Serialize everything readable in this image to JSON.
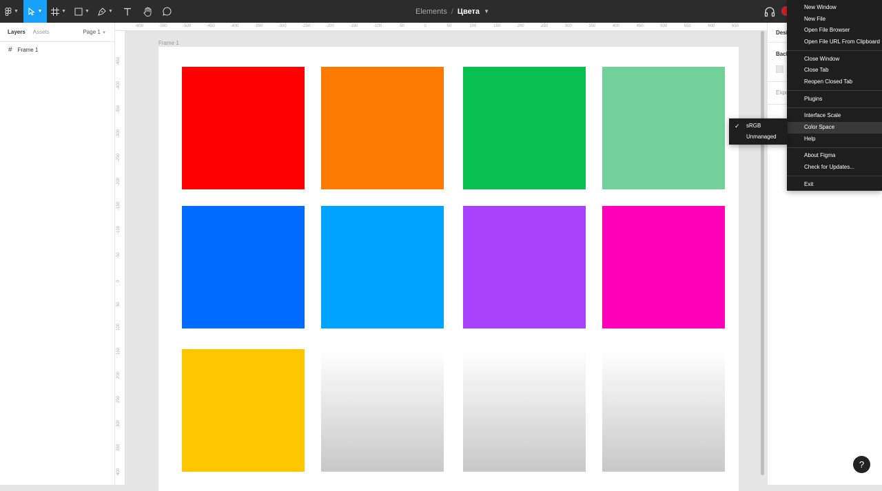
{
  "toolbar": {
    "tools": [
      {
        "name": "main-menu-icon"
      },
      {
        "name": "move-icon"
      },
      {
        "name": "frame-icon"
      },
      {
        "name": "shape-icon"
      },
      {
        "name": "pen-icon"
      },
      {
        "name": "text-icon"
      },
      {
        "name": "hand-icon"
      },
      {
        "name": "comment-icon"
      }
    ],
    "active_color": "#18a0fb",
    "project": "Elements",
    "separator": "/",
    "file": "Цвета"
  },
  "left_panel": {
    "tab_layers": "Layers",
    "tab_assets": "Assets",
    "page": "Page 1",
    "layers": [
      {
        "name": "Frame 1"
      }
    ]
  },
  "canvas": {
    "frame_label": "Frame 1",
    "swatches": [
      {
        "color": "#ff0000"
      },
      {
        "color": "#ff7a00"
      },
      {
        "color": "#07c050"
      },
      {
        "color": "#73d09a"
      },
      {
        "color": "#006cff"
      },
      {
        "color": "#00a3ff"
      },
      {
        "color": "#a742ff"
      },
      {
        "color": "#ff00b8"
      },
      {
        "color": "#ffc700"
      },
      {
        "color": "gradient-light-gray"
      },
      {
        "color": "gradient-light-gray"
      },
      {
        "color": "gradient-light-gray"
      }
    ]
  },
  "rulers": {
    "top": [
      "-600",
      "-550",
      "-500",
      "-450",
      "-400",
      "-350",
      "-300",
      "-250",
      "-200",
      "-150",
      "-100",
      "-50",
      "0",
      "50",
      "100",
      "150",
      "200",
      "250",
      "300",
      "350",
      "400",
      "450",
      "500",
      "550",
      "600",
      "650"
    ],
    "left": [
      "-450",
      "-400",
      "-350",
      "-300",
      "-250",
      "-200",
      "-150",
      "-100",
      "-50",
      "0",
      "50",
      "100",
      "150",
      "200",
      "250",
      "300",
      "350",
      "400"
    ]
  },
  "right_panel": {
    "tab": "Desi",
    "background": "Back",
    "export": "Expo"
  },
  "menu": {
    "groups": [
      [
        "New Window",
        "New File",
        "Open File Browser",
        "Open File URL From Clipboard"
      ],
      [
        "Close Window",
        "Close Tab",
        "Reopen Closed Tab"
      ],
      [
        "Plugins"
      ],
      [
        "Interface Scale",
        "Color Space",
        "Help"
      ],
      [
        "About Figma",
        "Check for Updates..."
      ],
      [
        "Exit"
      ]
    ],
    "highlighted": "Color Space"
  },
  "submenu": {
    "items": [
      "sRGB",
      "Unmanaged"
    ],
    "checked": "sRGB"
  },
  "help_button": "?"
}
